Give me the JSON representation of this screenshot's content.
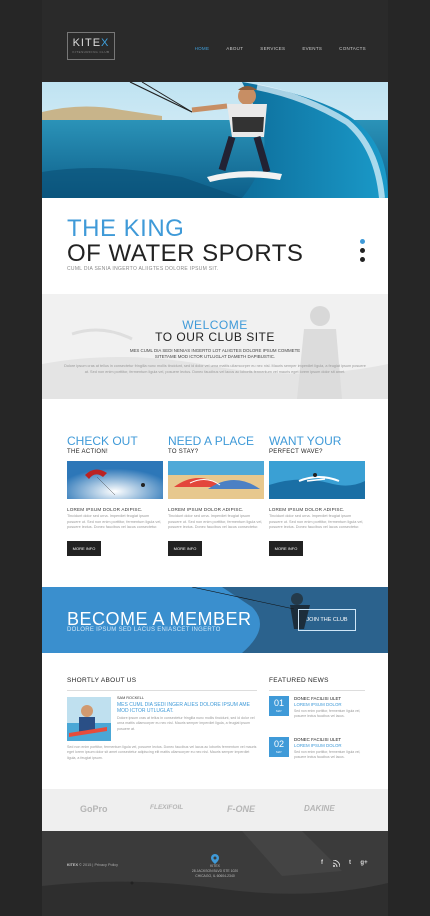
{
  "header": {
    "logo_main": "KITE",
    "logo_accent": "X",
    "logo_sub": "KITESURFING CLUB",
    "nav": [
      {
        "label": "HOME",
        "active": true
      },
      {
        "label": "ABOUT",
        "active": false
      },
      {
        "label": "SERVICES",
        "active": false
      },
      {
        "label": "EVENTS",
        "active": false
      },
      {
        "label": "CONTACTS",
        "active": false
      }
    ]
  },
  "tagline": {
    "line1": "THE KING",
    "line2": "OF WATER SPORTS",
    "sub": "CUML DIA SENIA INGERTO ALIIGTES DOLORE IPSUM SIT."
  },
  "welcome": {
    "title1": "WELCOME",
    "title2": "TO OUR CLUB SITE",
    "intro": "MES CUML DIA SEDI NENIAS INGERTO LOT ALIIGTES DOLORE IPSUM COMMETE SITETAME MOD ICTOR UTLUGLAT DAMETH DAPIBUSTIC.",
    "body": "Dolore ipsum cras at tellus in consectetur fringilla nunc mollis tincidunt, sed id dolor vel urna mattis ullamcorper eu nec nisl. Mauris semper imperdiet ligula, a feugiat ipsum posuere at. Sed non enim porttitor, fermentum ligula vel, posuere lectus. Donec faucibus vel lacus ac lobortis fermentum vel mauris eget lorem ipsum dolor sit amet."
  },
  "features": [
    {
      "title": "CHECK OUT",
      "subtitle": "THE ACTION!",
      "caption": "LOREM IPSUM DOLOR ADIPISC.",
      "text": "Tincidunt dolor sed urna. Imperdiet feugiat ipsum posuere ut. Sed non enim porttitor, fermentum ligula vel, posuere lectus. Donec faucibus vel lacus consectetur.",
      "button": "MORE INFO"
    },
    {
      "title": "NEED A PLACE",
      "subtitle": "TO STAY?",
      "caption": "LOREM IPSUM DOLOR ADIPISC.",
      "text": "Tincidunt dolor sed urna. Imperdiet feugiat ipsum posuere ut. Sed non enim porttitor, fermentum ligula vel, posuere lectus. Donec faucibus vel lacus consectetur.",
      "button": "MORE INFO"
    },
    {
      "title": "WANT YOUR",
      "subtitle": "PERFECT WAVE?",
      "caption": "LOREM IPSUM DOLOR ADIPISC.",
      "text": "Tincidunt dolor sed urna. Imperdiet feugiat ipsum posuere ut. Sed non enim porttitor, fermentum ligula vel, posuere lectus. Donec faucibus vel lacus consectetur.",
      "button": "MORE INFO"
    }
  ],
  "member": {
    "title": "BECOME A MEMBER",
    "subtitle": "DOLORE IPSUM SED LACUS ENIASCET INGERTO",
    "button": "JOIN THE CLUB"
  },
  "about": {
    "heading": "SHORTLY ABOUT US",
    "name": "SAM ROCKELL",
    "highlight": "MES CUML DIA SEDI INGER ALIES DOLORE IPSUM AME MOD ICTOR UTLUGLAT.",
    "text": "Dolore ipsum cras at tellus in consectetur fringilla nunc mollis tincidunt, sed id dolor vel urna mattis ullamcorper eu nec nisl. Mauris semper imperdiet ligula, a feugiat ipsum posuere at.",
    "text2": "Sed non enim porttitor, fermentum ligula vel, posuere lectus. Donec faucibus vel lacus ac lobortis fermentum vel mauris eget lorem ipsum dolor sit amet consectetur adipiscing elit mattis ullamcorper eu nec nisl. Mauris semper imperdiet ligula, a feugiat ipsum."
  },
  "news": {
    "heading": "FEATURED NEWS",
    "items": [
      {
        "day": "01",
        "month": "MAY",
        "title": "DONEC FACILISI ULET",
        "sub": "LOREM IPSUM DOLOR",
        "text": "Sed non enim porttitor, fermentum ligula vel, posuere lectus faucibus vel lacus."
      },
      {
        "day": "02",
        "month": "MAY",
        "title": "DONEC FACILISI ULET",
        "sub": "LOREM IPSUM DOLOR",
        "text": "Sed non enim porttitor, fermentum ligula vel, posuere lectus faucibus vel lacus."
      }
    ]
  },
  "brands": [
    "GoPro",
    "FLEXIFOIL",
    "F-ONE",
    "DAKINE"
  ],
  "footer": {
    "brand": "KITEX",
    "copy": "© 2015 | Privacy Policy",
    "addr1": "KITEX",
    "addr2": "28 JACKSON BLVD STE 1020",
    "addr3": "CHICAGO, IL 60604-2340",
    "social": [
      "f",
      "rss",
      "t",
      "g+"
    ]
  },
  "colors": {
    "accent": "#3f9ad8",
    "dark": "#2a2a2a",
    "member_bg": "#3a8fce"
  }
}
